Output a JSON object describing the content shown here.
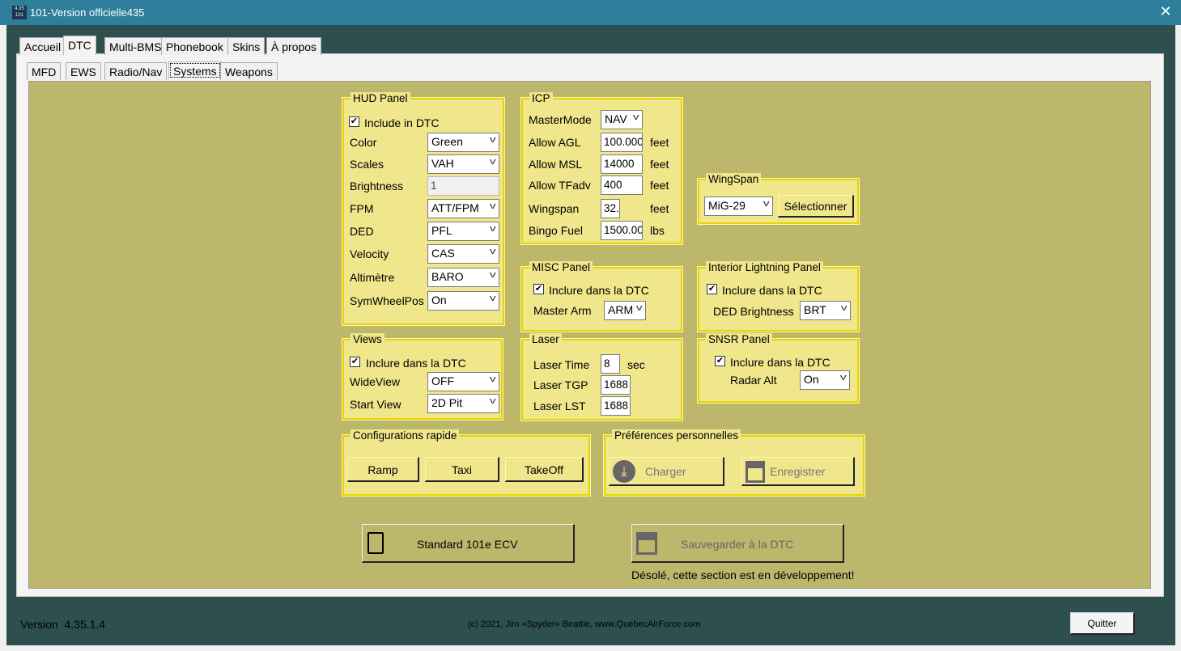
{
  "window": {
    "title": "101-Version officielle435",
    "icon_text": "4.35 101"
  },
  "main_tabs": [
    "Accueil",
    "DTC",
    "Multi-BMS",
    "Phonebook",
    "Skins",
    "À propos"
  ],
  "main_tab_selected": "DTC",
  "sub_tabs": [
    "MFD",
    "EWS",
    "Radio/Nav",
    "Systems",
    "Weapons"
  ],
  "sub_tab_selected": "Systems",
  "hud": {
    "title": "HUD Panel",
    "include_label": "Include in DTC",
    "include_checked": true,
    "rows": [
      {
        "label": "Color",
        "value": "Green",
        "type": "combo"
      },
      {
        "label": "Scales",
        "value": "VAH",
        "type": "combo"
      },
      {
        "label": "Brightness",
        "value": "1",
        "type": "disabled-input"
      },
      {
        "label": "FPM",
        "value": "ATT/FPM",
        "type": "combo"
      },
      {
        "label": "DED",
        "value": "PFL",
        "type": "combo"
      },
      {
        "label": "Velocity",
        "value": "CAS",
        "type": "combo"
      },
      {
        "label": "Altimètre",
        "value": "BARO",
        "type": "combo"
      },
      {
        "label": "SymWheelPos",
        "value": "On",
        "type": "combo"
      }
    ]
  },
  "icp": {
    "title": "ICP",
    "mastermode_label": "MasterMode",
    "mastermode_value": "NAV",
    "rows": [
      {
        "label": "Allow AGL",
        "value": "100.000",
        "unit": "feet"
      },
      {
        "label": "Allow MSL",
        "value": "14000",
        "unit": "feet"
      },
      {
        "label": "Allow TFadv",
        "value": "400",
        "unit": "feet"
      },
      {
        "label": "Wingspan",
        "value": "32.",
        "unit": "feet"
      },
      {
        "label": "Bingo Fuel",
        "value": "1500.00",
        "unit": "lbs"
      }
    ]
  },
  "wingspan": {
    "title": "WingSpan",
    "value": "MiG-29",
    "button": "Sélectionner"
  },
  "misc": {
    "title": "MISC Panel",
    "include_label": "Inclure dans la DTC",
    "include_checked": true,
    "masterarm_label": "Master Arm",
    "masterarm_value": "ARM"
  },
  "interior": {
    "title": "Interior Lightning Panel",
    "include_label": "Inclure dans la DTC",
    "include_checked": true,
    "ded_label": "DED Brightness",
    "ded_value": "BRT"
  },
  "views": {
    "title": "Views",
    "include_label": "Inclure dans la DTC",
    "include_checked": true,
    "wideview_label": "WideView",
    "wideview_value": "OFF",
    "startview_label": "Start View",
    "startview_value": "2D Pit"
  },
  "laser": {
    "title": "Laser",
    "rows": [
      {
        "label": "Laser Time",
        "value": "8",
        "unit": "sec"
      },
      {
        "label": "Laser TGP",
        "value": "1688"
      },
      {
        "label": "Laser LST",
        "value": "1688"
      }
    ]
  },
  "snsr": {
    "title": "SNSR Panel",
    "include_label": "Inclure dans la DTC",
    "include_checked": true,
    "radar_label": "Radar Alt",
    "radar_value": "On"
  },
  "quick": {
    "title": "Configurations rapide",
    "buttons": [
      "Ramp",
      "Taxi",
      "TakeOff"
    ]
  },
  "prefs": {
    "title": "Préférences personnelles",
    "load": "Charger",
    "save": "Enregistrer"
  },
  "actions": {
    "standard": "Standard 101e ECV",
    "save_dtc": "Sauvegarder à la DTC",
    "dev_note": "Désolé, cette section est en développement!"
  },
  "footer": {
    "version_label": "Version",
    "version": "4.35.1.4",
    "copyright": "(c) 2021, Jim «Spyder» Beattie, www.QuebecAirForce.com",
    "quit": "Quitter"
  },
  "colors": {
    "titlebar": "#2f7f9c",
    "body": "#2f4f4f",
    "panel": "#bdb76b",
    "groupbox": "#f0e68c"
  }
}
